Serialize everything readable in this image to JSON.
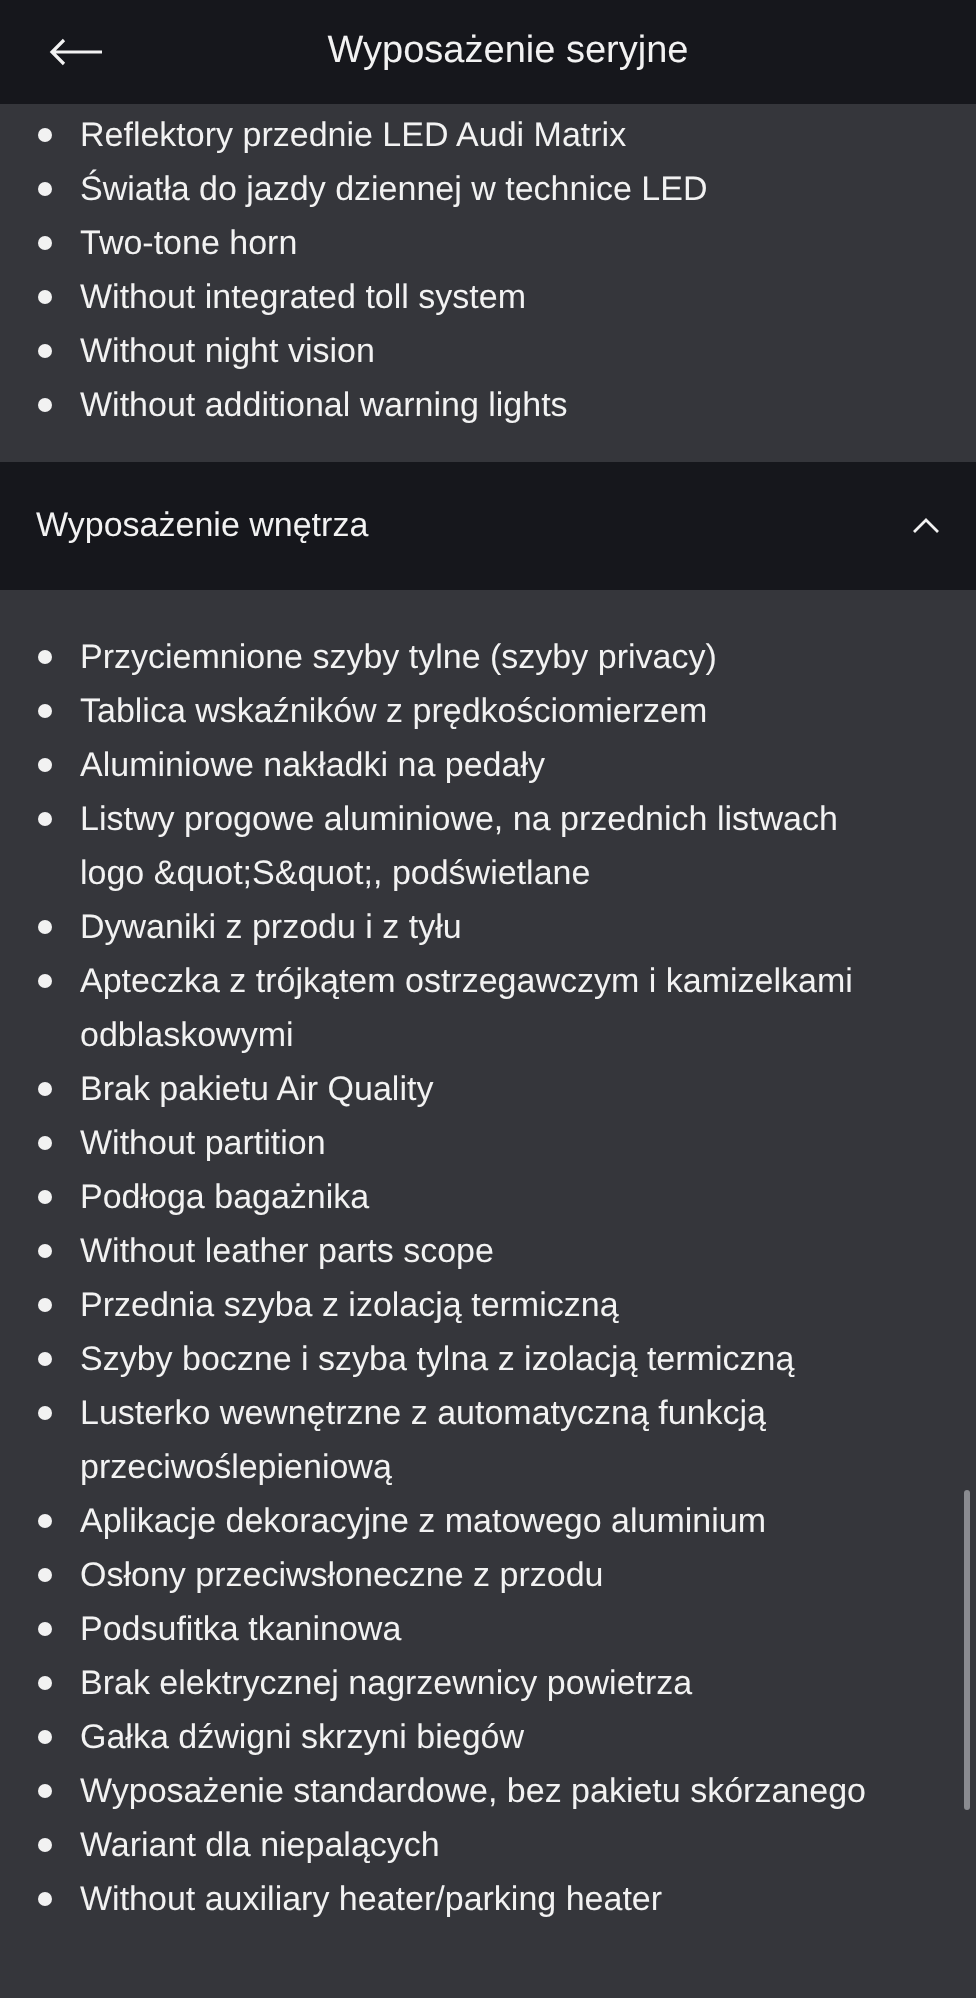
{
  "header": {
    "title": "Wyposażenie seryjne"
  },
  "sections": [
    {
      "items": [
        "Reflektory przednie LED Audi Matrix",
        "Światła do jazdy dziennej w technice LED",
        "Two-tone horn",
        "Without integrated toll system",
        "Without night vision",
        "Without additional warning lights"
      ]
    },
    {
      "title": "Wyposażenie wnętrza",
      "expanded": true,
      "items": [
        "Przyciemnione szyby tylne (szyby privacy)",
        "Tablica wskaźników z prędkościomierzem",
        "Aluminiowe nakładki na pedały",
        "Listwy progowe aluminiowe, na przednich listwach logo &quot;S&quot;, podświetlane",
        "Dywaniki z przodu i z tyłu",
        "Apteczka z trójkątem ostrzegawczym i kamizelkami odblaskowymi",
        "Brak pakietu Air Quality",
        "Without partition",
        "Podłoga bagażnika",
        "Without leather parts scope",
        "Przednia szyba z izolacją termiczną",
        "Szyby boczne i szyba tylna z izolacją termiczną",
        "Lusterko wewnętrzne z automatyczną funkcją przeciwoślepieniową",
        "Aplikacje dekoracyjne z matowego aluminium",
        "Osłony przeciwsłoneczne z przodu",
        "Podsufitka tkaninowa",
        "Brak elektrycznej nagrzewnicy powietrza",
        "Gałka dźwigni skrzyni biegów",
        "Wyposażenie standardowe, bez pakietu skórzanego",
        "Wariant dla niepalących",
        "Without auxiliary heater/parking heater"
      ]
    }
  ]
}
